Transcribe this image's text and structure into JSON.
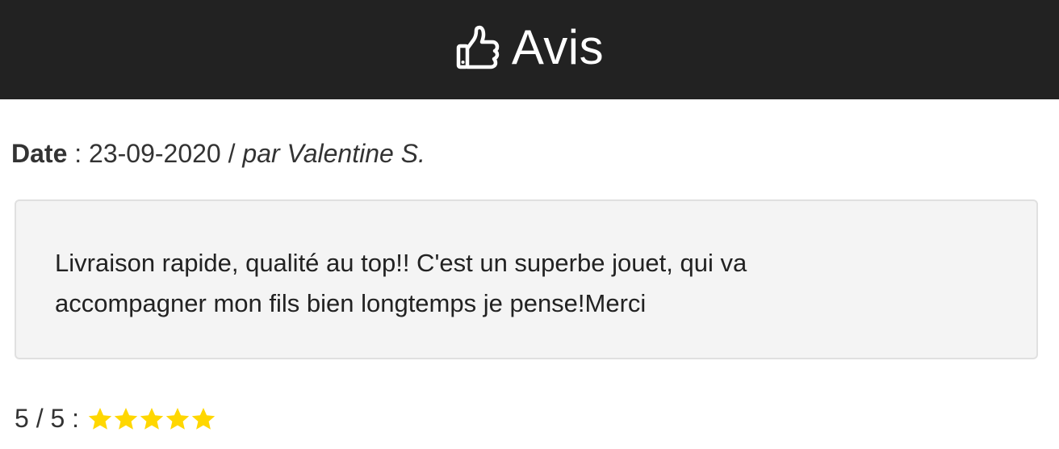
{
  "header": {
    "icon": "thumbs-up-icon",
    "title": "Avis"
  },
  "review": {
    "date_label": "Date",
    "date_separator": " : ",
    "date": "23-09-2020",
    "by_separator": " / ",
    "by_author": "par Valentine S.",
    "text": "Livraison rapide, qualité au top!! C'est un superbe jouet, qui va accompagner mon fils bien longtemps je pense!Merci",
    "rating_text": "5 / 5 :",
    "rating_value": 5,
    "rating_max": 5
  },
  "colors": {
    "header_bg": "#222222",
    "box_bg": "#f4f4f4",
    "star": "#ffd700"
  }
}
